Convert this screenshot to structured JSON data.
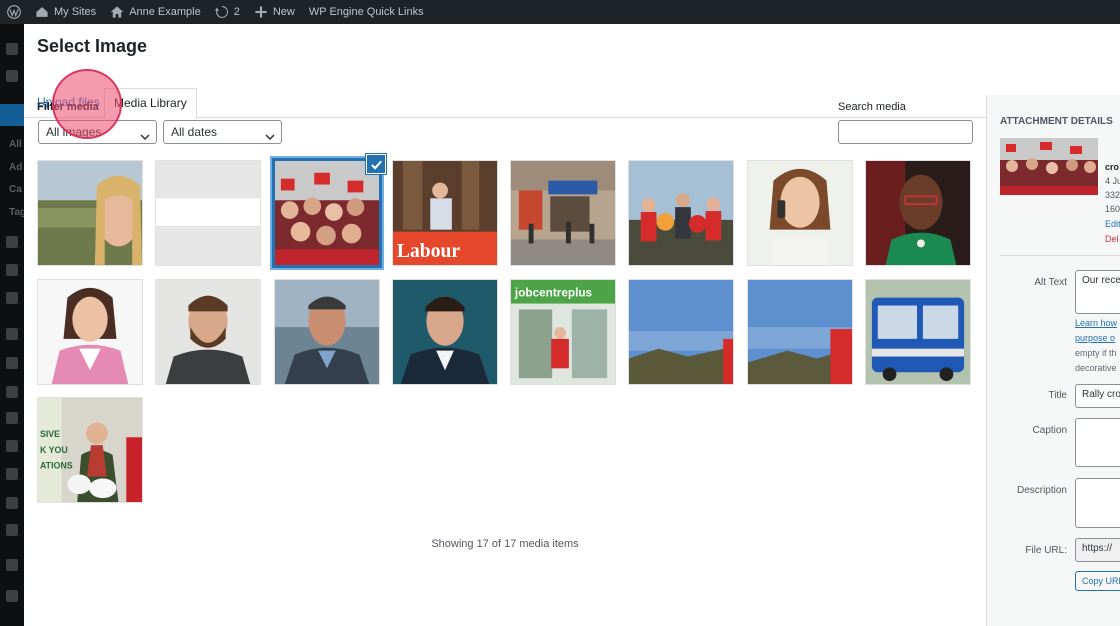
{
  "adminbar": {
    "items": [
      {
        "label": "",
        "icon": "wordpress-icon"
      },
      {
        "label": "My Sites",
        "icon": "sites-icon"
      },
      {
        "label": "Anne Example",
        "icon": "home-icon"
      },
      {
        "label": "2",
        "icon": "updates-icon"
      },
      {
        "label": "New",
        "icon": "plus-icon"
      },
      {
        "label": "WP Engine Quick Links",
        "icon": ""
      }
    ]
  },
  "sidemenu": {
    "texts": [
      "All",
      "Ad",
      "Ca",
      "Tag"
    ]
  },
  "modal": {
    "title": "Select Image",
    "tabs": {
      "upload": "Upload files",
      "library": "Media Library"
    },
    "filter": {
      "label": "Filter media",
      "type_selected": "All images",
      "date_selected": "All dates"
    },
    "search": {
      "label": "Search media",
      "value": ""
    },
    "showing": "Showing 17 of 17 media items",
    "accent": "#2271b1",
    "highlight_color": "#ec486e"
  },
  "media_items": [
    {
      "id": 1,
      "subject": "woman selfie landscape"
    },
    {
      "id": 2,
      "subject": "placeholder"
    },
    {
      "id": 3,
      "subject": "rally crowd",
      "selected": true
    },
    {
      "id": 4,
      "subject": "speaker at labour podium"
    },
    {
      "id": 5,
      "subject": "street shops"
    },
    {
      "id": 6,
      "subject": "campaigners with placards"
    },
    {
      "id": 7,
      "subject": "woman on phone"
    },
    {
      "id": 8,
      "subject": "woman with glasses"
    },
    {
      "id": 9,
      "subject": "woman pink jacket"
    },
    {
      "id": 10,
      "subject": "bearded man"
    },
    {
      "id": 11,
      "subject": "older man at sea"
    },
    {
      "id": 12,
      "subject": "man portrait blue"
    },
    {
      "id": 13,
      "subject": "jobcentre plus"
    },
    {
      "id": 14,
      "subject": "coast view"
    },
    {
      "id": 15,
      "subject": "coast view red scarf"
    },
    {
      "id": 16,
      "subject": "blue bus"
    },
    {
      "id": 17,
      "subject": "woman with bags"
    }
  ],
  "attachment": {
    "heading": "ATTACHMENT DETAILS",
    "filename": "cro",
    "date": "4 Ju",
    "size": "332",
    "dimensions": "160",
    "edit_link": "Edit",
    "delete_link": "Del",
    "alt_label": "Alt Text",
    "alt_value": "Our rece",
    "alt_help_link1": "Learn how",
    "alt_help_link2": "purpose o",
    "alt_help_text1": "empty if th",
    "alt_help_text2": "decorative",
    "title_label": "Title",
    "title_value": "Rally cro",
    "caption_label": "Caption",
    "caption_value": "",
    "description_label": "Description",
    "description_value": "",
    "url_label": "File URL:",
    "url_value": "https://",
    "copy_button": "Copy URL"
  }
}
